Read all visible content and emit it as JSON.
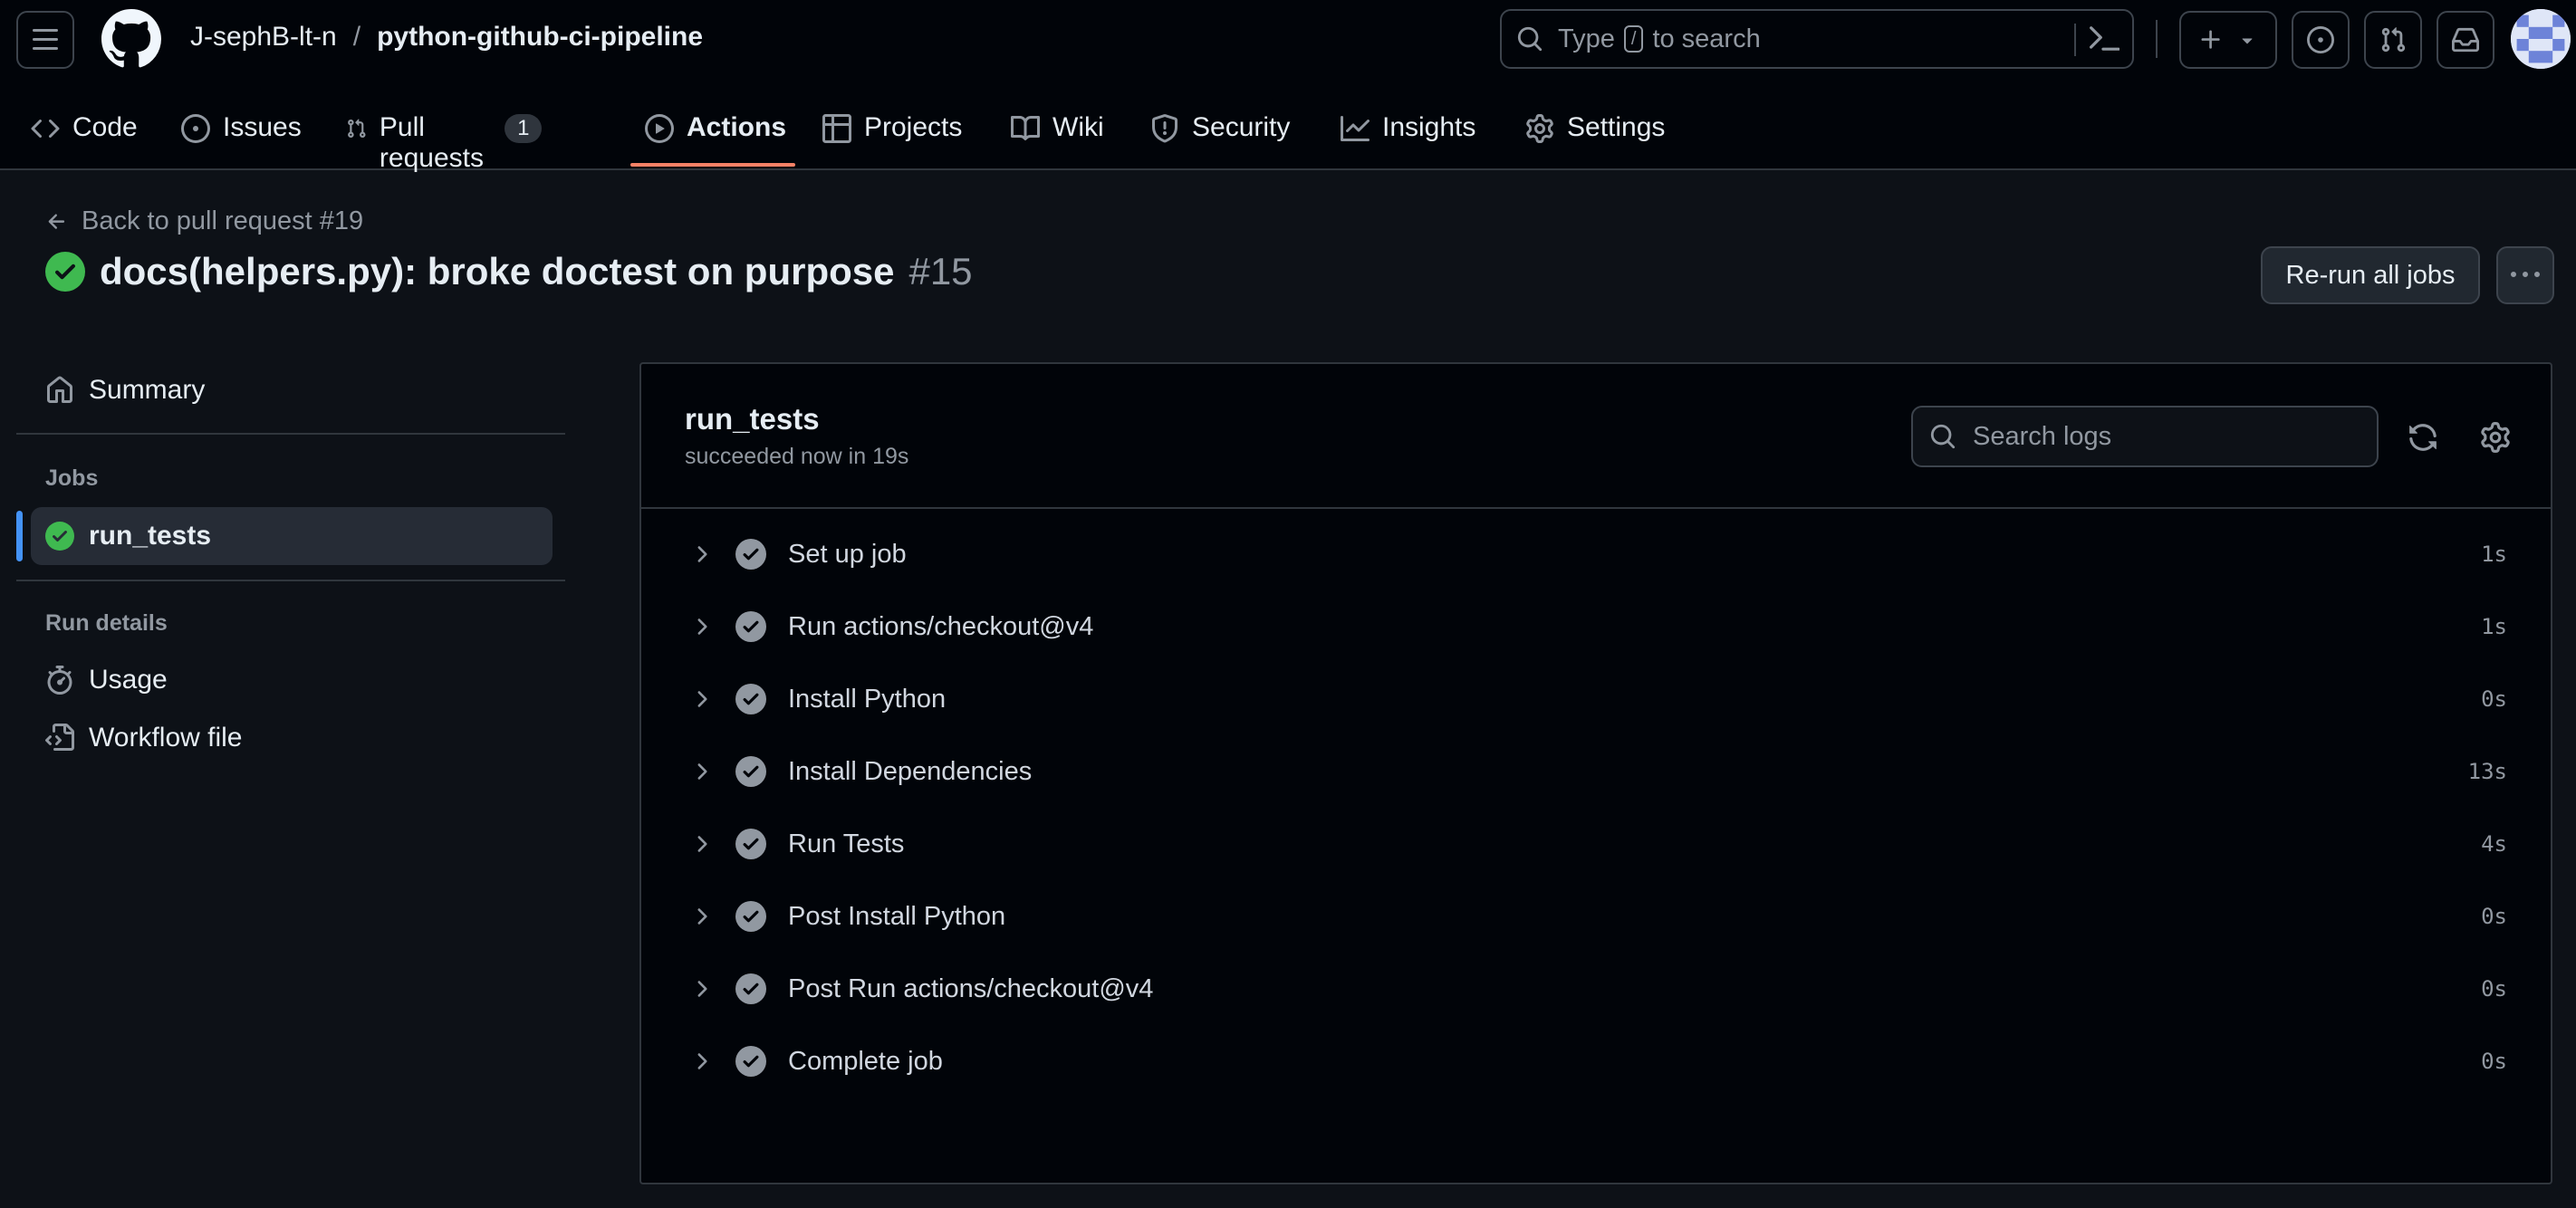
{
  "topbar": {
    "owner": "J-sephB-lt-n",
    "separator": "/",
    "repo": "python-github-ci-pipeline",
    "search": {
      "prefix": "Type",
      "key": "/",
      "suffix": "to search"
    }
  },
  "repo_nav": [
    {
      "label": "Code",
      "icon": "code-icon"
    },
    {
      "label": "Issues",
      "icon": "issue-icon"
    },
    {
      "label": "Pull requests",
      "icon": "pull-request-icon",
      "count": "1"
    },
    {
      "label": "Actions",
      "icon": "play-icon",
      "active": true
    },
    {
      "label": "Projects",
      "icon": "table-icon"
    },
    {
      "label": "Wiki",
      "icon": "book-icon"
    },
    {
      "label": "Security",
      "icon": "shield-icon"
    },
    {
      "label": "Insights",
      "icon": "graph-icon"
    },
    {
      "label": "Settings",
      "icon": "gear-icon"
    }
  ],
  "header": {
    "back_link": "Back to pull request #19",
    "title": "docs(helpers.py): broke doctest on purpose",
    "run_number": "#15",
    "rerun_label": "Re-run all jobs"
  },
  "sidebar": {
    "summary": "Summary",
    "jobs_heading": "Jobs",
    "active_job": "run_tests",
    "run_details_heading": "Run details",
    "usage": "Usage",
    "workflow_file": "Workflow file"
  },
  "job": {
    "name": "run_tests",
    "status": "succeeded now in 19s",
    "search_placeholder": "Search logs",
    "steps": [
      {
        "label": "Set up job",
        "duration": "1s"
      },
      {
        "label": "Run actions/checkout@v4",
        "duration": "1s"
      },
      {
        "label": "Install Python",
        "duration": "0s"
      },
      {
        "label": "Install Dependencies",
        "duration": "13s"
      },
      {
        "label": "Run Tests",
        "duration": "4s"
      },
      {
        "label": "Post Install Python",
        "duration": "0s"
      },
      {
        "label": "Post Run actions/checkout@v4",
        "duration": "0s"
      },
      {
        "label": "Complete job",
        "duration": "0s"
      }
    ]
  },
  "colors": {
    "success": "#3fb950",
    "accent_underline": "#f78166",
    "selected_marker": "#4493f8",
    "background": "#0d1117"
  }
}
